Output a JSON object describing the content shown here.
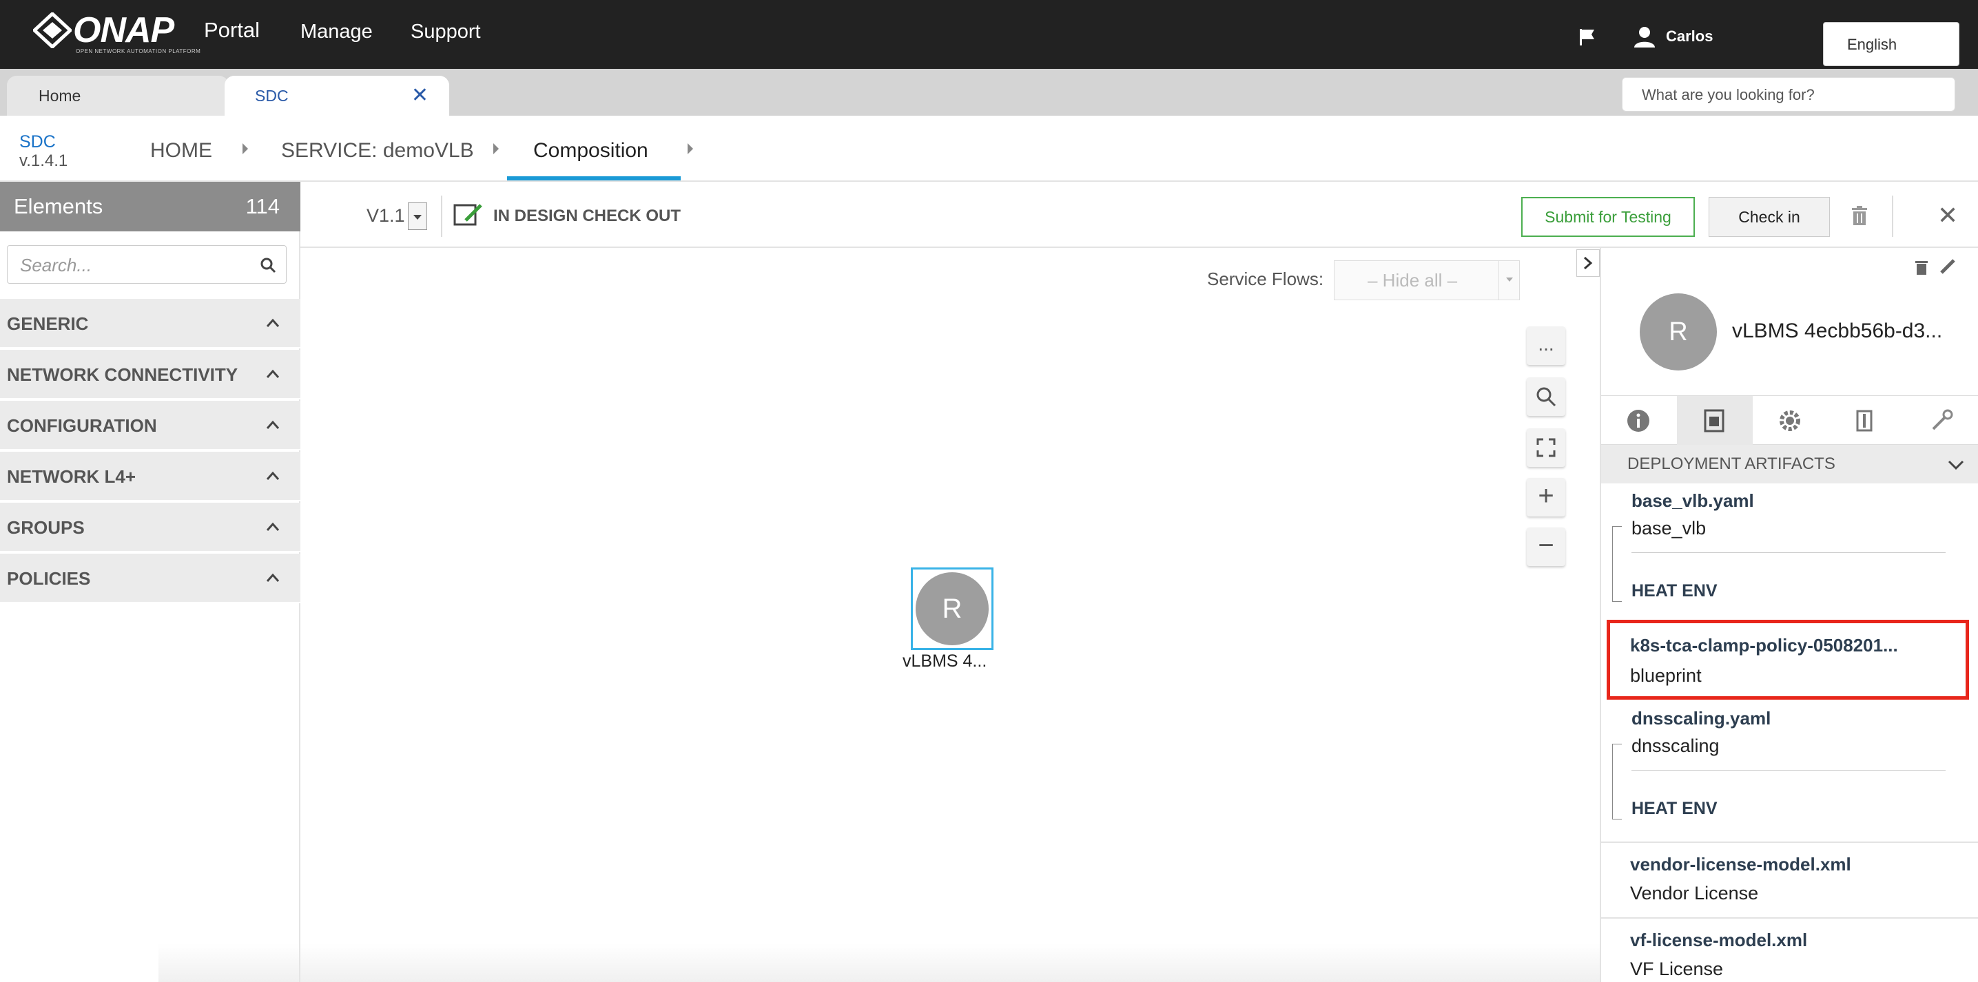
{
  "topbar": {
    "logo_text": "ONAP",
    "logo_subtitle": "OPEN NETWORK AUTOMATION PLATFORM",
    "portal": "Portal",
    "nav": [
      "Manage",
      "Support"
    ],
    "user": "Carlos",
    "language": "English"
  },
  "tabs": {
    "home": "Home",
    "sdc": "SDC",
    "close_glyph": "✕",
    "search_placeholder": "What are you looking for?"
  },
  "breadcrumb": {
    "app_name": "SDC",
    "app_version": "v.1.4.1",
    "items": [
      "HOME",
      "SERVICE: demoVLB",
      "Composition"
    ]
  },
  "sidebar": {
    "title": "Elements",
    "count": "114",
    "search_placeholder": "Search...",
    "categories": [
      "GENERIC",
      "NETWORK CONNECTIVITY",
      "CONFIGURATION",
      "NETWORK L4+",
      "GROUPS",
      "POLICIES"
    ]
  },
  "toolbar": {
    "version": "V1.1",
    "status": "IN DESIGN CHECK OUT",
    "submit_label": "Submit for Testing",
    "checkin_label": "Check in",
    "close_glyph": "✕"
  },
  "canvas": {
    "service_flows_label": "Service Flows:",
    "service_flows_value": "– Hide all –",
    "zoom_buttons": [
      "...",
      "search-icon",
      "fit-icon",
      "+",
      "−"
    ],
    "node_letter": "R",
    "node_label": "vLBMS 4..."
  },
  "right_panel": {
    "avatar_letter": "R",
    "title": "vLBMS 4ecbb56b-d3...",
    "tabs": [
      "info-icon",
      "artifacts-icon",
      "settings-icon",
      "api-icon",
      "wrench-icon"
    ],
    "section_title": "DEPLOYMENT ARTIFACTS",
    "artifacts": [
      {
        "name": "base_vlb.yaml",
        "type": "base_vlb",
        "env": "HEAT ENV"
      },
      {
        "name": "k8s-tca-clamp-policy-0508201...",
        "type": "blueprint"
      },
      {
        "name": "dnsscaling.yaml",
        "type": "dnsscaling",
        "env": "HEAT ENV"
      },
      {
        "name": "vendor-license-model.xml",
        "type": "Vendor License"
      },
      {
        "name": "vf-license-model.xml",
        "type": "VF License"
      }
    ]
  },
  "colors": {
    "topbar_bg": "#222222",
    "accent_blue": "#1a9ad6",
    "submit_green": "#4caf50",
    "highlight_red": "#e8261b"
  }
}
